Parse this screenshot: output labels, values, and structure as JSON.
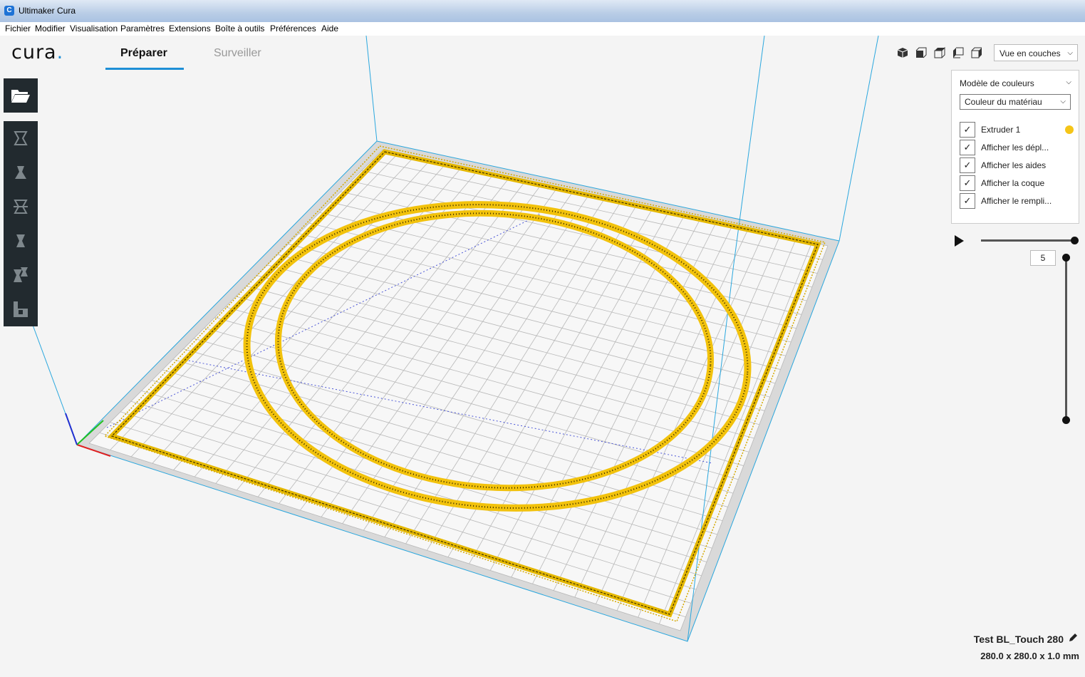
{
  "window": {
    "title": "Ultimaker Cura",
    "app_icon": "C"
  },
  "menu": [
    "Fichier",
    "Modifier",
    "Visualisation",
    "Paramètres",
    "Extensions",
    "Boîte à outils",
    "Préférences",
    "Aide"
  ],
  "logo": {
    "text": "cura",
    "dot": "."
  },
  "tabs": {
    "prepare": "Préparer",
    "monitor": "Surveiller"
  },
  "colors": {
    "accent": "#1e8fd6",
    "toolbar": "#222a2f",
    "filament": "#f5c518",
    "build_volume": "#2aa7de"
  },
  "toolbar": {
    "open_icon": "folder-open-icon",
    "tools": [
      "move-icon",
      "scale-icon",
      "rotate-icon",
      "mirror-icon",
      "per-model-settings-icon",
      "support-blocker-icon"
    ]
  },
  "view": {
    "camera_icons": [
      "3d-view-icon",
      "front-view-icon",
      "top-view-icon",
      "left-view-icon",
      "right-view-icon"
    ],
    "mode": "Vue en couches"
  },
  "layer_panel": {
    "color_scheme_label": "Modèle de couleurs",
    "color_scheme_value": "Couleur du matériau",
    "options": [
      {
        "label": "Extruder 1",
        "checked": true,
        "swatch": "#f5c518"
      },
      {
        "label": "Afficher les dépl...",
        "checked": true
      },
      {
        "label": "Afficher les aides",
        "checked": true
      },
      {
        "label": "Afficher la coque",
        "checked": true
      },
      {
        "label": "Afficher le rempli...",
        "checked": true
      }
    ]
  },
  "layer_slider": {
    "current_layer": "5"
  },
  "printer": {
    "name": "Test BL_Touch 280",
    "dimensions": "280.0 x 280.0 x 1.0 mm"
  }
}
